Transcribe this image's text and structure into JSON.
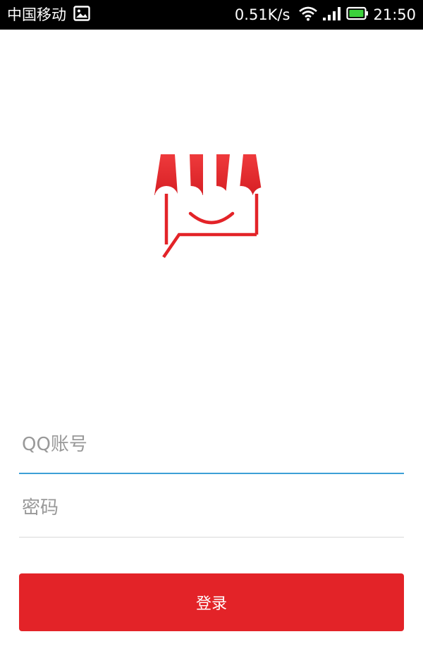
{
  "status_bar": {
    "carrier": "中国移动",
    "network_speed": "0.51K/s",
    "time": "21:50",
    "icons": [
      "image-notification-icon",
      "wifi-icon",
      "signal-icon",
      "battery-icon"
    ]
  },
  "login": {
    "qq_placeholder": "QQ账号",
    "password_placeholder": "密码",
    "login_button": "登录"
  },
  "colors": {
    "brand_red": "#e32328",
    "focus_underline": "#3d9fd6",
    "battery_green": "#3cd13c"
  }
}
